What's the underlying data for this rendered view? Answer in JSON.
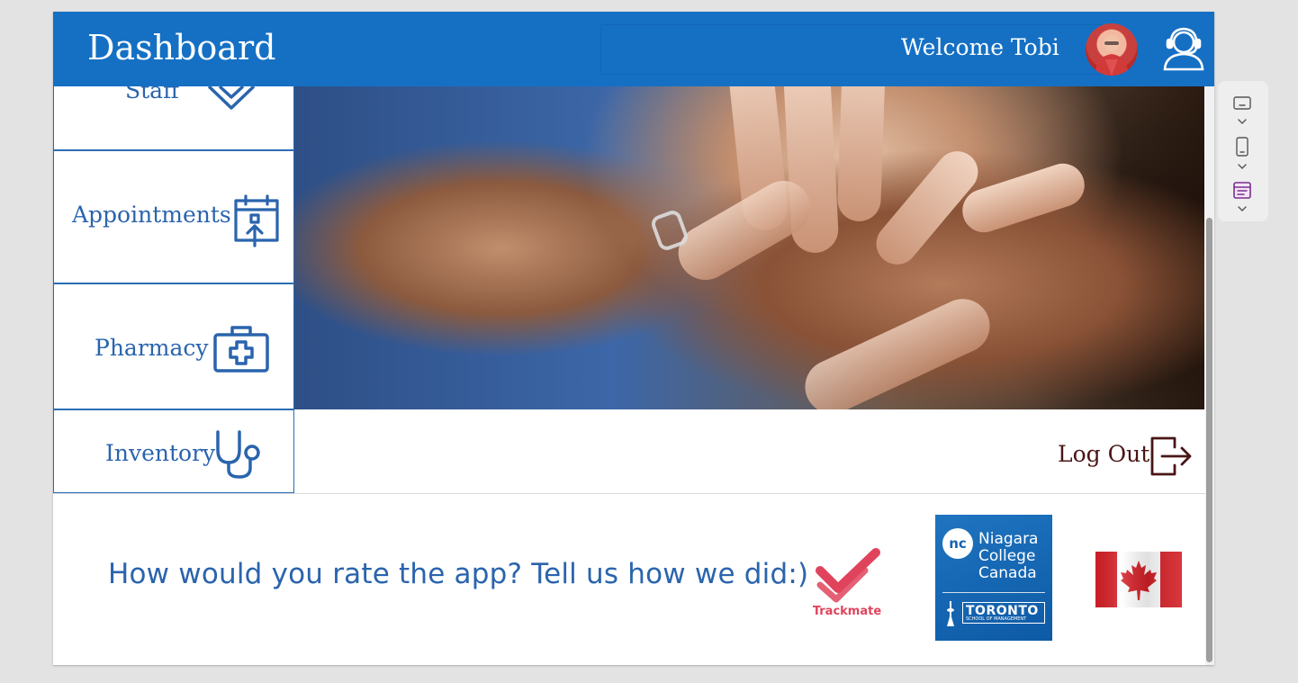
{
  "header": {
    "title": "Dashboard",
    "welcome_text": "Welcome Tobi"
  },
  "menu": {
    "items": [
      {
        "label": "Staff",
        "icon": "staff-badge-icon"
      },
      {
        "label": "Appointments",
        "icon": "calendar-upload-icon"
      },
      {
        "label": "Pharmacy",
        "icon": "medical-kit-icon"
      },
      {
        "label": "Inventory",
        "icon": "stethoscope-icon"
      }
    ]
  },
  "hero": {
    "image": "holding-hands-photo"
  },
  "logout": {
    "label": "Log Out",
    "icon": "logout-icon"
  },
  "footer": {
    "rate_prompt": "How would you rate the app? Tell us how we did:)",
    "logos": {
      "trackmate": "Trackmate",
      "niagara": {
        "badge": "nc",
        "line1": "Niagara",
        "line2": "College",
        "line3": "Canada",
        "campus": "TORONTO",
        "campus_sub": "SCHOOL OF MANAGEMENT"
      },
      "flag": "canada-flag"
    }
  },
  "colors": {
    "header_bg": "#1570c4",
    "menu_text": "#2a64ad",
    "logout_text": "#4a1616",
    "trackmate_red": "#e0445c"
  },
  "side_panel": {
    "icons": [
      "desktop-view-icon",
      "phone-view-icon",
      "form-view-icon"
    ]
  }
}
